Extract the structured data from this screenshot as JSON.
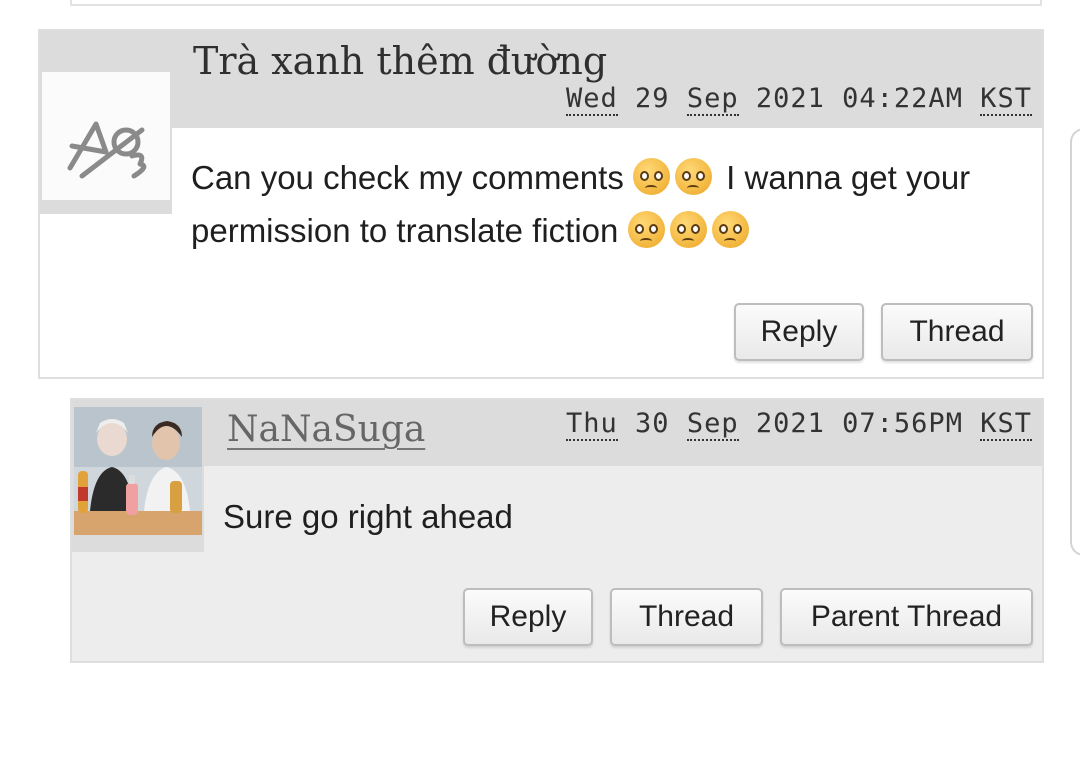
{
  "comments": [
    {
      "username": "Trà xanh thêm đường",
      "date": {
        "day": "Wed",
        "date": "29",
        "month": "Sep",
        "year": "2021",
        "time": "04:22AM",
        "tz": "KST"
      },
      "body_line1": "Can you check my comments",
      "body_line1b": "I wanna get your",
      "body_line2": "permission to translate fiction",
      "emoji_name": "pleading-face",
      "buttons": {
        "reply": "Reply",
        "thread": "Thread"
      }
    },
    {
      "username": "NaNaSuga",
      "date": {
        "day": "Thu",
        "date": "30",
        "month": "Sep",
        "year": "2021",
        "time": "07:56PM",
        "tz": "KST"
      },
      "body": "Sure go right ahead",
      "buttons": {
        "reply": "Reply",
        "thread": "Thread",
        "parent": "Parent Thread"
      }
    }
  ],
  "colors": {
    "header_bg": "#dcdcdc",
    "reply_bg": "#ededed",
    "border": "#dedede"
  }
}
